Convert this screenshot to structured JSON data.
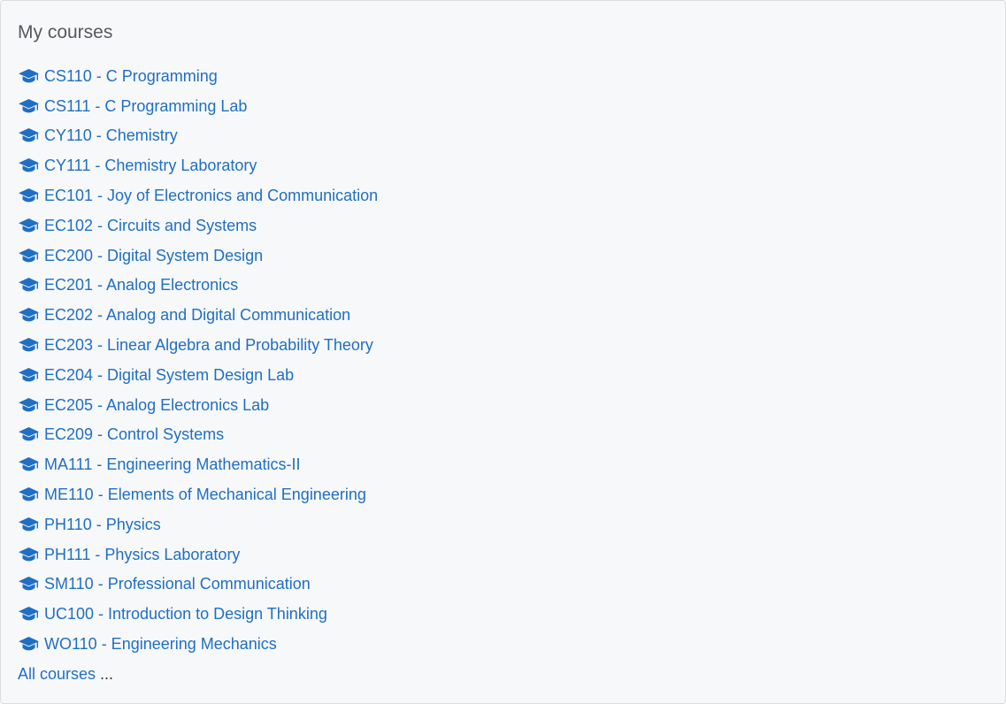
{
  "block": {
    "title": "My courses",
    "all_courses_label": "All courses",
    "all_courses_suffix": " ..."
  },
  "courses": [
    {
      "label": "CS110 - C Programming",
      "icon": "graduation-cap-icon"
    },
    {
      "label": "CS111 - C Programming Lab",
      "icon": "graduation-cap-icon"
    },
    {
      "label": "CY110 - Chemistry",
      "icon": "graduation-cap-icon"
    },
    {
      "label": "CY111 - Chemistry Laboratory",
      "icon": "graduation-cap-icon"
    },
    {
      "label": "EC101 - Joy of Electronics and Communication",
      "icon": "graduation-cap-icon"
    },
    {
      "label": "EC102 - Circuits and Systems",
      "icon": "graduation-cap-icon"
    },
    {
      "label": "EC200 - Digital System Design",
      "icon": "graduation-cap-icon"
    },
    {
      "label": "EC201 - Analog Electronics",
      "icon": "graduation-cap-icon"
    },
    {
      "label": "EC202 - Analog and Digital Communication",
      "icon": "graduation-cap-icon"
    },
    {
      "label": "EC203 - Linear Algebra and Probability Theory",
      "icon": "graduation-cap-icon"
    },
    {
      "label": "EC204 - Digital System Design Lab",
      "icon": "graduation-cap-icon"
    },
    {
      "label": "EC205 - Analog Electronics Lab",
      "icon": "graduation-cap-icon"
    },
    {
      "label": "EC209 - Control Systems",
      "icon": "graduation-cap-icon"
    },
    {
      "label": "MA111 - Engineering Mathematics-II",
      "icon": "graduation-cap-icon"
    },
    {
      "label": "ME110 - Elements of Mechanical Engineering",
      "icon": "graduation-cap-icon"
    },
    {
      "label": "PH110 - Physics",
      "icon": "graduation-cap-icon"
    },
    {
      "label": "PH111 - Physics Laboratory",
      "icon": "graduation-cap-icon"
    },
    {
      "label": "SM110 - Professional Communication",
      "icon": "graduation-cap-icon"
    },
    {
      "label": "UC100 - Introduction to Design Thinking",
      "icon": "graduation-cap-icon"
    },
    {
      "label": "WO110 - Engineering Mechanics",
      "icon": "graduation-cap-icon"
    }
  ],
  "colors": {
    "link": "#1f6fc4",
    "title": "#555a5f",
    "background": "#f7f8fa",
    "border": "#dcdcdc"
  }
}
